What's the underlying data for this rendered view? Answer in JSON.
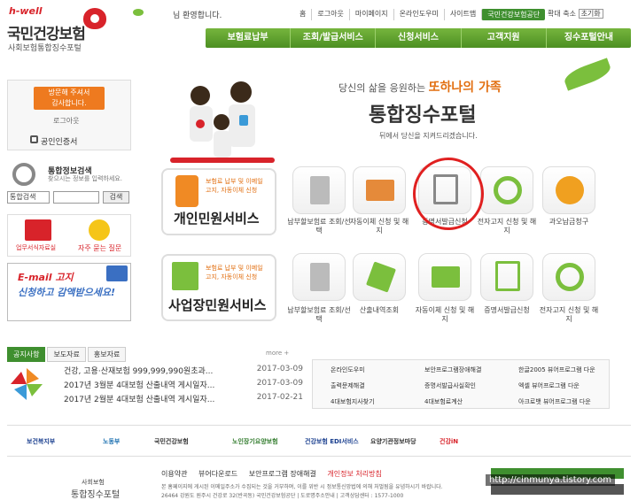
{
  "logo": {
    "small": "h-well",
    "main": "국민건강보험",
    "sub": "사회보험통합징수포털"
  },
  "header": {
    "greeting": "님 환영합니다.",
    "nav": [
      "홈",
      "로그아웃",
      "마이페이지",
      "온라인도우미",
      "사이트맵"
    ],
    "highlight": "국민건강보험공단",
    "zoom": [
      "확대",
      "축소",
      "초기화"
    ]
  },
  "gnb": [
    "보험료납부",
    "조회/발급서비스",
    "신청서비스",
    "고객지원",
    "징수포털안내"
  ],
  "login": {
    "btn_line1": "방문해 주셔서",
    "btn_line2": "감사합니다.",
    "logout": "로그아웃",
    "cert": "공인인증서"
  },
  "search": {
    "title": "통합정보검색",
    "sub": "찾으시는 정보를 입력하세요.",
    "select": "통합검색",
    "button": "검색"
  },
  "quick": {
    "item1": "업무서식자료실",
    "item2": "자주 묻는 질문"
  },
  "banner": {
    "line1": "E-mail 고지",
    "line2": "신청하고 감액받으세요!"
  },
  "hero": {
    "line1_pre": "당신의 삶을 응원하는",
    "line1_hl": "또하나의 가족",
    "title": "통합징수포털",
    "sub": "뒤에서 당신을 지켜드리겠습니다."
  },
  "personal": {
    "desc1": "보험료 납부 및 이메일",
    "desc2": "고지, 자동이체 신청",
    "title": "개인민원서비스",
    "tiles": [
      "납부할보험료 조회/선택",
      "자동이체 신청 및 해지",
      "증명서발급신청",
      "전자고지 신청 및 해지",
      "과오납금청구"
    ]
  },
  "business": {
    "desc1": "보험료 납부 및 이메일",
    "desc2": "고지, 자동이체 신청",
    "title": "사업장민원서비스",
    "tiles": [
      "납부할보험료 조회/선택",
      "산출내역조회",
      "자동이체 신청 및 해지",
      "증명서발급신청",
      "전자고지 신청 및 해지"
    ]
  },
  "notice": {
    "tabs": [
      "공지사항",
      "보도자료",
      "홍보자료"
    ],
    "more": "more +",
    "items": [
      {
        "title": "건강, 고용·산재보험 999,999,990원초과...",
        "date": "2017-03-09"
      },
      {
        "title": "2017년 3월분 4대보험 산출내역 게시일자...",
        "date": "2017-03-09"
      },
      {
        "title": "2017년 2월분 4대보험 산출내역 게시일자...",
        "date": "2017-02-21"
      }
    ]
  },
  "links": [
    "온라인도우미",
    "보안프로그램장애해결",
    "한글2005 뷰어프로그램 다운",
    "출력문제해결",
    "증명서발급사실확인",
    "엑셀 뷰어프로그램 다운",
    "4대보험지사찾기",
    "4대보험료계산",
    "아크로뱃 뷰어프로그램 다운"
  ],
  "partners": [
    "보건복지부",
    "노동부",
    "국민건강보험",
    "노인장기요양보험",
    "건강보험 EDI서비스",
    "요양기관정보마당",
    "건강iN"
  ],
  "footer": {
    "logo1": "사회보험",
    "logo2": "통합징수포털",
    "nav": [
      "이용약관",
      "뷰어다운로드",
      "보안프로그램 장애해결",
      "개인정보 처리방침"
    ],
    "addr1": "본 홈페이지에 게시된 이메일주소가 수집되는 것을 거부하며, 이를 위반 시 정보통신망법에 의해 처벌됨을 유념하시기 바랍니다.",
    "addr2": "26464 강원도 원주시 건강로 32(반곡동) 국민건강보험공단 | 도로명주소안내 | 고객상담센터 : 1577-1000",
    "watermark": "http://cinmunya.tistory.com"
  }
}
